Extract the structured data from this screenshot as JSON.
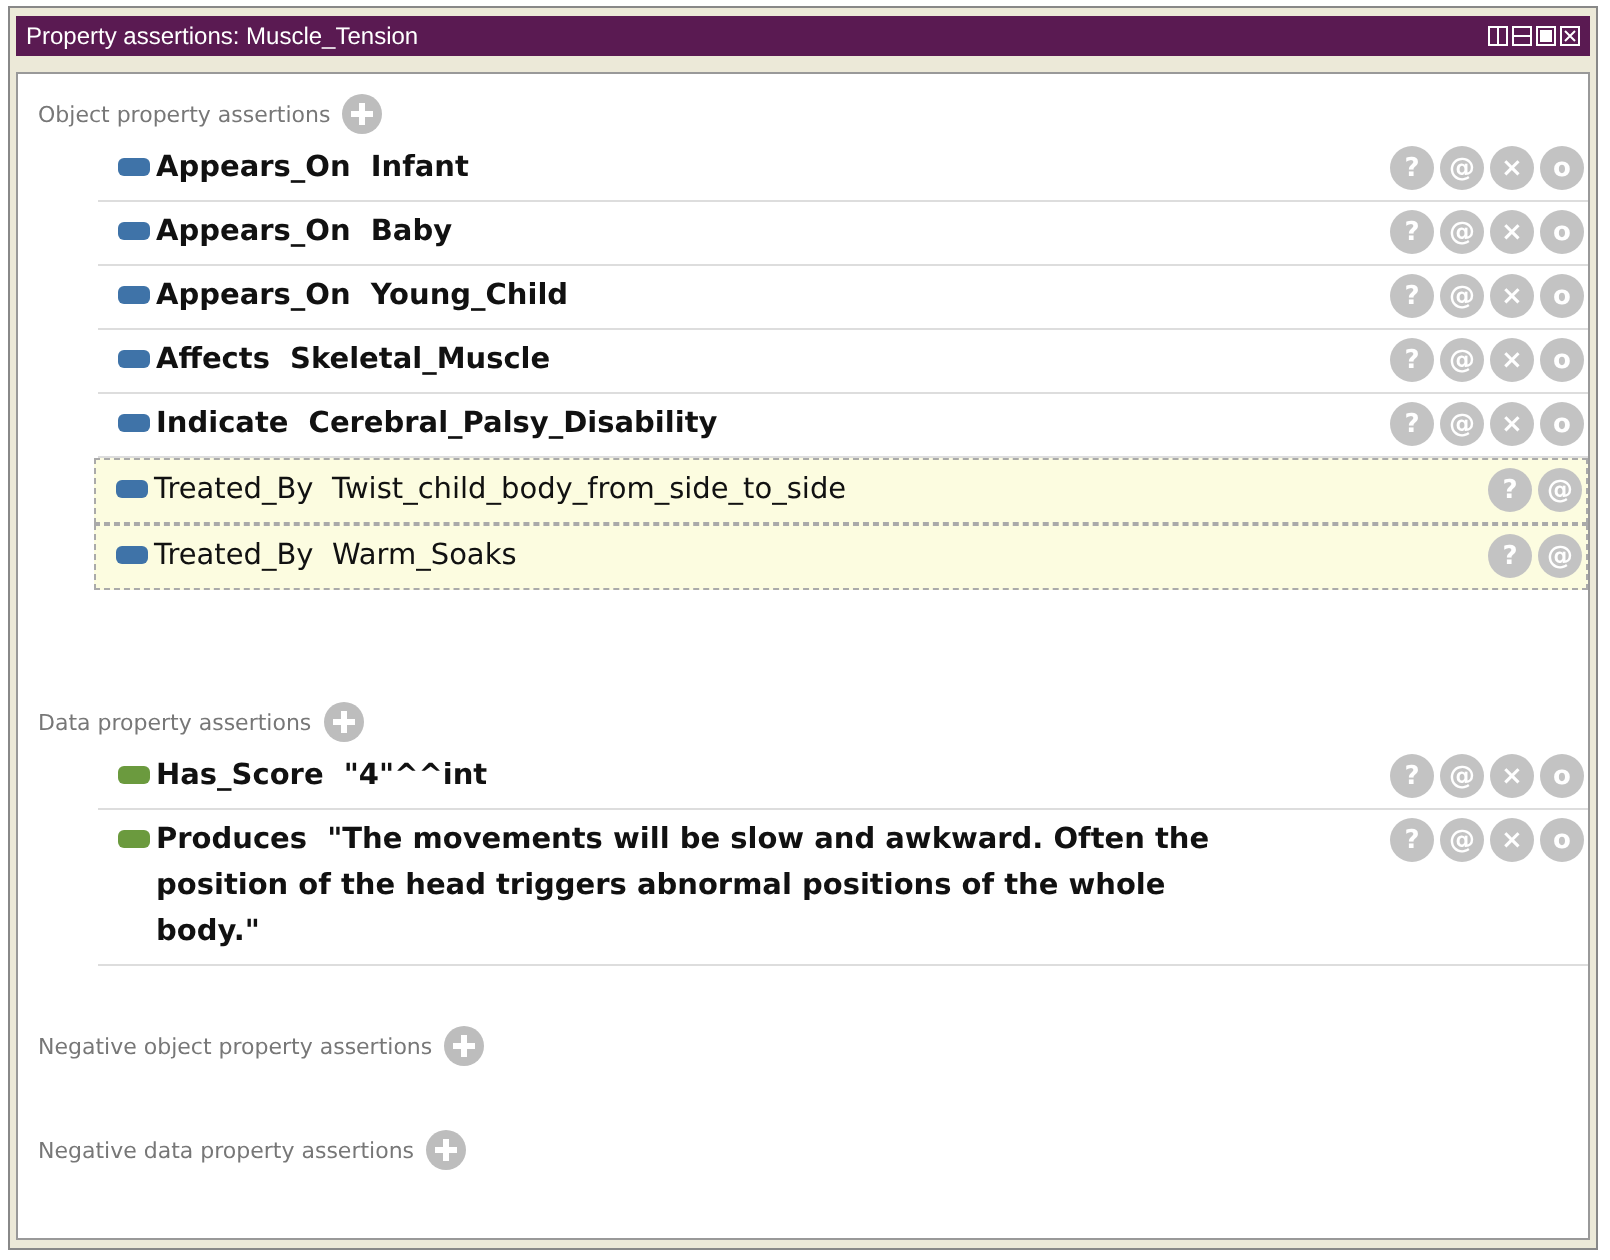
{
  "window": {
    "title": "Property assertions: Muscle_Tension"
  },
  "sections": [
    {
      "title": "Object property assertions",
      "kind": "object",
      "rows": [
        {
          "property": "Appears_On",
          "value": "Infant",
          "inferred": false,
          "buttons": [
            "?",
            "@",
            "×",
            "o"
          ]
        },
        {
          "property": "Appears_On",
          "value": "Baby",
          "inferred": false,
          "buttons": [
            "?",
            "@",
            "×",
            "o"
          ]
        },
        {
          "property": "Appears_On",
          "value": "Young_Child",
          "inferred": false,
          "buttons": [
            "?",
            "@",
            "×",
            "o"
          ]
        },
        {
          "property": "Affects",
          "value": "Skeletal_Muscle",
          "inferred": false,
          "buttons": [
            "?",
            "@",
            "×",
            "o"
          ]
        },
        {
          "property": "Indicate",
          "value": "Cerebral_Palsy_Disability",
          "inferred": false,
          "buttons": [
            "?",
            "@",
            "×",
            "o"
          ]
        },
        {
          "property": "Treated_By",
          "value": "Twist_child_body_from_side_to_side",
          "inferred": true,
          "buttons": [
            "?",
            "@"
          ]
        },
        {
          "property": "Treated_By",
          "value": "Warm_Soaks",
          "inferred": true,
          "buttons": [
            "?",
            "@"
          ]
        }
      ]
    },
    {
      "title": "Data property assertions",
      "kind": "data",
      "rows": [
        {
          "property": "Has_Score",
          "value": "\"4\"^^int",
          "inferred": false,
          "buttons": [
            "?",
            "@",
            "×",
            "o"
          ]
        },
        {
          "property": "Produces",
          "value": "\"The movements will be slow and awkward. Often the position of the head triggers abnormal positions of the whole body.\"",
          "inferred": false,
          "buttons": [
            "?",
            "@",
            "×",
            "o"
          ]
        }
      ]
    },
    {
      "title": "Negative object property assertions"
    },
    {
      "title": "Negative data property assertions"
    }
  ]
}
